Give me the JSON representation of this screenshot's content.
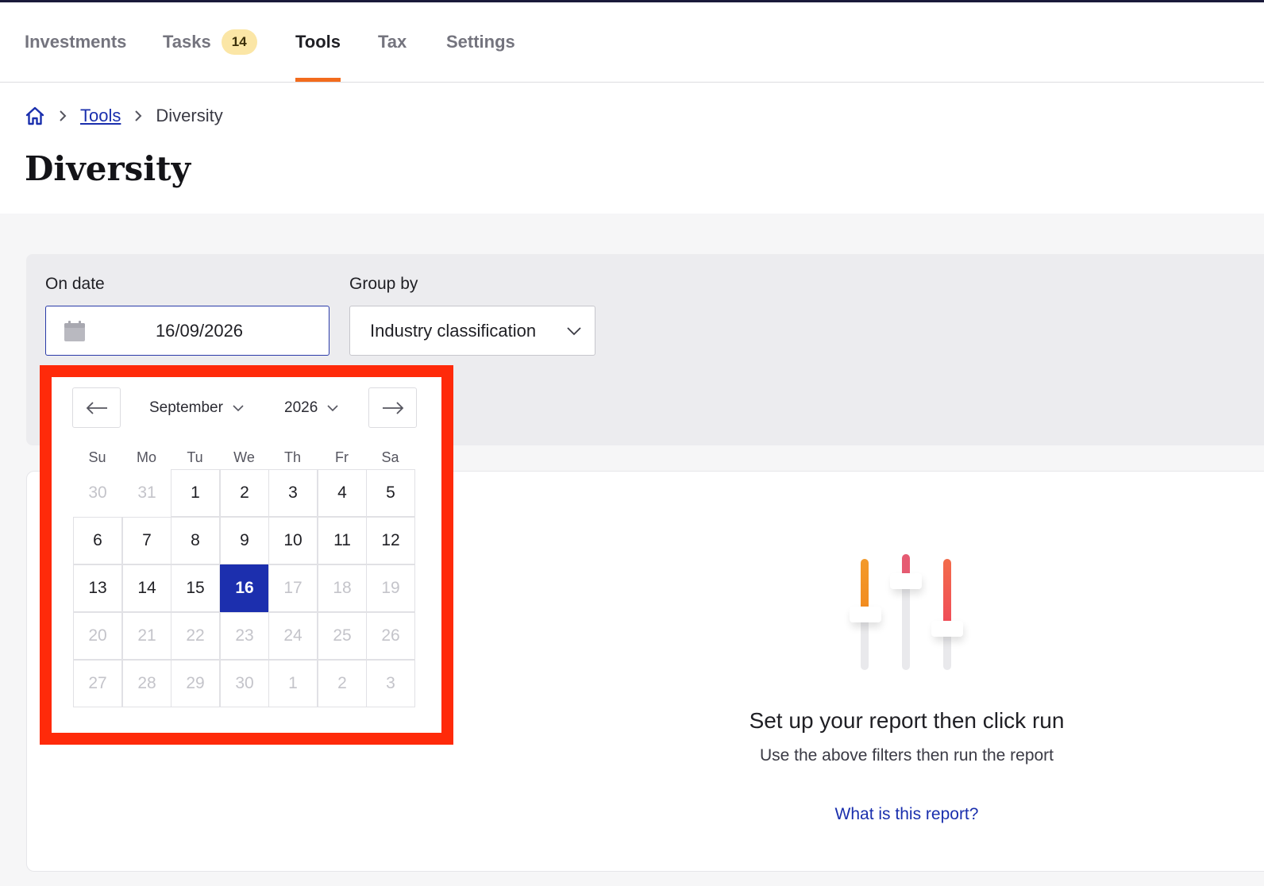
{
  "nav": {
    "tabs": [
      {
        "label": "Investments"
      },
      {
        "label": "Tasks",
        "badge": "14"
      },
      {
        "label": "Tools",
        "active": true
      },
      {
        "label": "Tax"
      },
      {
        "label": "Settings"
      }
    ]
  },
  "breadcrumb": {
    "home_icon": "home-icon",
    "items": [
      "Tools",
      "Diversity"
    ]
  },
  "page": {
    "title": "Diversity"
  },
  "filters": {
    "date_label": "On date",
    "date_value": "16/09/2026",
    "group_label": "Group by",
    "group_value": "Industry classification"
  },
  "datepicker": {
    "month": "September",
    "year": "2026",
    "weekdays": [
      "Su",
      "Mo",
      "Tu",
      "We",
      "Th",
      "Fr",
      "Sa"
    ],
    "weeks": [
      [
        {
          "d": "30",
          "m": true
        },
        {
          "d": "31",
          "m": true
        },
        {
          "d": "1"
        },
        {
          "d": "2"
        },
        {
          "d": "3"
        },
        {
          "d": "4"
        },
        {
          "d": "5"
        }
      ],
      [
        {
          "d": "6"
        },
        {
          "d": "7"
        },
        {
          "d": "8"
        },
        {
          "d": "9"
        },
        {
          "d": "10"
        },
        {
          "d": "11"
        },
        {
          "d": "12"
        }
      ],
      [
        {
          "d": "13"
        },
        {
          "d": "14"
        },
        {
          "d": "15"
        },
        {
          "d": "16",
          "s": true
        },
        {
          "d": "17",
          "m": true
        },
        {
          "d": "18",
          "m": true
        },
        {
          "d": "19",
          "m": true
        }
      ],
      [
        {
          "d": "20",
          "m": true
        },
        {
          "d": "21",
          "m": true
        },
        {
          "d": "22",
          "m": true
        },
        {
          "d": "23",
          "m": true
        },
        {
          "d": "24",
          "m": true
        },
        {
          "d": "25",
          "m": true
        },
        {
          "d": "26",
          "m": true
        }
      ],
      [
        {
          "d": "27",
          "m": true
        },
        {
          "d": "28",
          "m": true
        },
        {
          "d": "29",
          "m": true
        },
        {
          "d": "30",
          "m": true
        },
        {
          "d": "1",
          "m": true
        },
        {
          "d": "2",
          "m": true
        },
        {
          "d": "3",
          "m": true
        }
      ]
    ],
    "highlight_color": "#ff2a0a",
    "selected_color": "#1c2fae"
  },
  "empty_state": {
    "title": "Set up your report then click run",
    "subtitle": "Use the above filters then run the report",
    "link": "What is this report?",
    "icon": "sliders-icon"
  },
  "colors": {
    "accent": "#f26b1d",
    "link": "#1a2fad",
    "badge_bg": "#fbe6a6"
  }
}
